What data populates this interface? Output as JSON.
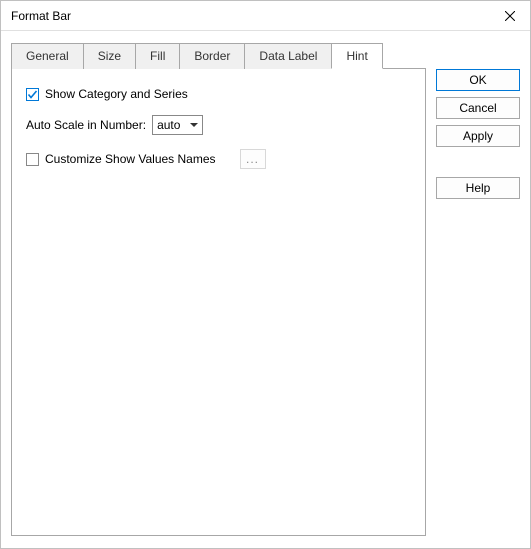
{
  "titlebar": {
    "title": "Format Bar"
  },
  "tabs": {
    "general": "General",
    "size": "Size",
    "fill": "Fill",
    "border": "Border",
    "data_label": "Data Label",
    "hint": "Hint"
  },
  "hint_panel": {
    "show_category_label": "Show Category and Series",
    "auto_scale_label": "Auto Scale in Number:",
    "auto_scale_value": "auto",
    "customize_label": "Customize Show Values Names",
    "ellipsis": "..."
  },
  "buttons": {
    "ok": "OK",
    "cancel": "Cancel",
    "apply": "Apply",
    "help": "Help"
  }
}
